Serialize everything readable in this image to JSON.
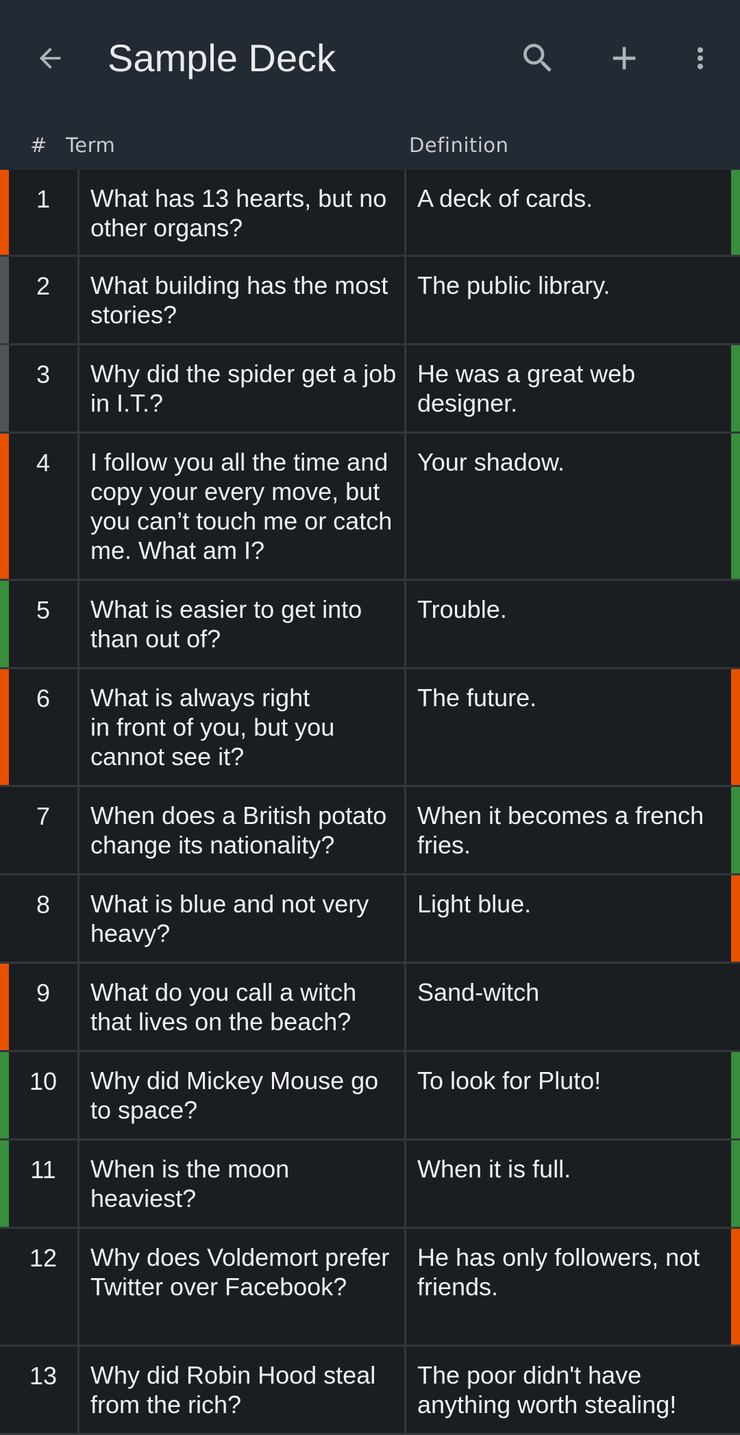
{
  "appbar": {
    "title": "Sample Deck",
    "icons": {
      "back": "back-arrow-icon",
      "search": "search-icon",
      "add": "add-icon",
      "more": "more-vert-icon"
    }
  },
  "columns": {
    "number": "#",
    "term": "Term",
    "definition": "Definition"
  },
  "colors": {
    "appbar": "#222a33",
    "background": "#1b1e21",
    "orange": "#e65100",
    "green": "#388e3c",
    "gray": "#505358"
  },
  "rows": [
    {
      "number": "1",
      "term": "What has 13 hearts, but no other organs?",
      "definition": "A deck of cards.",
      "left": "orange",
      "right": "green"
    },
    {
      "number": "2",
      "term": "What building has the most stories?",
      "definition": "The public library.",
      "left": "gray",
      "right": ""
    },
    {
      "number": "3",
      "term": "Why did the spider get a job in I.T.?",
      "definition": "He was a great web designer.",
      "left": "gray",
      "right": "green"
    },
    {
      "number": "4",
      "term": "I follow you all the time and copy your every move, but you can’t touch me or catch me. What am I?",
      "definition": "Your shadow.",
      "left": "orange",
      "right": "green"
    },
    {
      "number": "5",
      "term": "What is easier to get into than out of?",
      "definition": "Trouble.",
      "left": "green",
      "right": ""
    },
    {
      "number": "6",
      "term": "What is always right\nin front of you, but you cannot see it?",
      "definition": "The future.",
      "left": "orange",
      "right": "orange"
    },
    {
      "number": "7",
      "term": "When does a British potato change its nationality?",
      "definition": "When it becomes a french fries.",
      "left": "",
      "right": "green"
    },
    {
      "number": "8",
      "term": "What is blue and not very heavy?",
      "definition": "Light blue.",
      "left": "",
      "right": "orange"
    },
    {
      "number": "9",
      "term": "What do you call a witch that lives on the beach?",
      "definition": "Sand-witch",
      "left": "orange",
      "right": ""
    },
    {
      "number": "10",
      "term": "Why did Mickey Mouse go to space?",
      "definition": "To look for Pluto!",
      "left": "green",
      "right": "green"
    },
    {
      "number": "11",
      "term": "When is the moon heaviest?",
      "definition": "When it is full.",
      "left": "green",
      "right": "green"
    },
    {
      "number": "12",
      "term": "Why does Voldemort prefer Twitter over Facebook?",
      "definition": "He has only followers, not friends.",
      "left": "",
      "right": "orange"
    },
    {
      "number": "13",
      "term": "Why did Robin Hood steal from the rich?",
      "definition": "The poor didn't have anything worth stealing!",
      "left": "",
      "right": ""
    }
  ]
}
